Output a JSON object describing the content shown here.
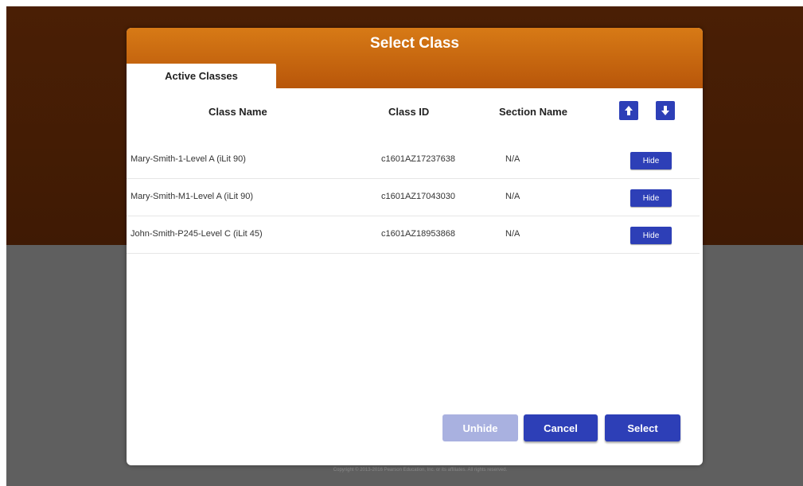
{
  "dialog": {
    "title": "Select Class",
    "tabs": [
      {
        "label": "Active Classes",
        "active": true
      }
    ]
  },
  "table": {
    "headers": {
      "class_name": "Class Name",
      "class_id": "Class ID",
      "section_name": "Section Name"
    },
    "rows": [
      {
        "class_name": "Mary-Smith-1-Level A (iLit 90)",
        "class_id": "c1601AZ17237638",
        "section_name": "N/A",
        "action": "Hide"
      },
      {
        "class_name": "Mary-Smith-M1-Level A (iLit 90)",
        "class_id": "c1601AZ17043030",
        "section_name": "N/A",
        "action": "Hide"
      },
      {
        "class_name": "John-Smith-P245-Level C (iLit 45)",
        "class_id": "c1601AZ18953868",
        "section_name": "N/A",
        "action": "Hide"
      }
    ]
  },
  "sort_buttons": {
    "up_icon": "↑",
    "down_icon": "↓"
  },
  "buttons": {
    "unhide": "Unhide",
    "cancel": "Cancel",
    "select": "Select"
  },
  "footer": {
    "copyright": "Copyright © 2013-2016 Pearson Education, Inc. or its affiliates. All rights reserved."
  },
  "colors": {
    "header_orange": "#c9690f",
    "button_blue": "#2d3fb7",
    "button_disabled": "#a9b1e0"
  }
}
